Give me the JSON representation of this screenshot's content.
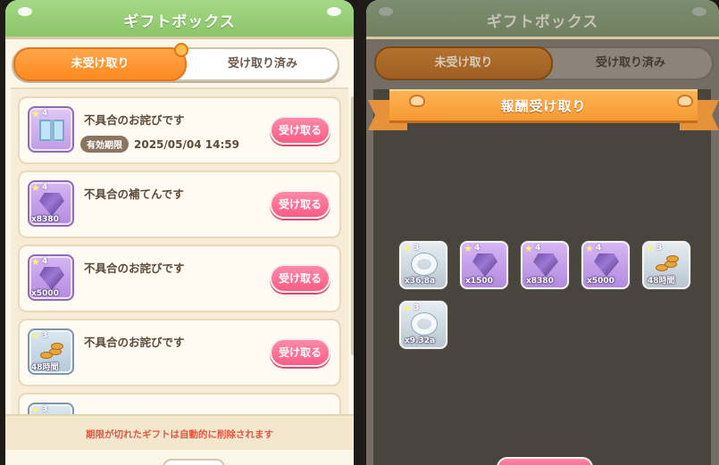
{
  "left": {
    "title": "ギフトボックス",
    "tabs": {
      "active": "未受け取り",
      "inactive": "受け取り済み"
    },
    "items": [
      {
        "name": "不具合のお詫びです",
        "rank": "4",
        "expiry_tag": "有効期限",
        "expiry_date": "2025/05/04 14:59",
        "qty": "",
        "button": "受け取る"
      },
      {
        "name": "不具合の補てんです",
        "rank": "4",
        "qty": "x8380",
        "button": "受け取る"
      },
      {
        "name": "不具合のお詫びです",
        "rank": "4",
        "qty": "x5000",
        "button": "受け取る"
      },
      {
        "name": "不具合のお詫びです",
        "rank": "3",
        "qty": "48時間",
        "button": "受け取る"
      },
      {
        "rank": "3"
      }
    ],
    "footer_note": "期限が切れたギフトは自動的に削除されます"
  },
  "right": {
    "title": "ギフトボックス",
    "tabs": {
      "active": "未受け取り",
      "inactive": "受け取り済み"
    },
    "dialog_title": "報酬受け取り",
    "rewards": [
      {
        "rank": "3",
        "qty": "x36.8a",
        "icon": "ring-icon"
      },
      {
        "rank": "4",
        "qty": "x1500",
        "icon": "gem-icon"
      },
      {
        "rank": "4",
        "qty": "x8380",
        "icon": "gem-icon"
      },
      {
        "rank": "4",
        "qty": "x5000",
        "icon": "gem-icon"
      },
      {
        "rank": "3",
        "qty": "48時間",
        "icon": "coin-stack-icon"
      },
      {
        "rank": "3",
        "qty": "x9.32a",
        "icon": "ring-icon"
      }
    ]
  },
  "colors": {
    "accent_orange": "#ff8a1f",
    "button_pink": "#ff5c85",
    "header_green": "#8cc56b",
    "warning_red": "#e5563e"
  }
}
